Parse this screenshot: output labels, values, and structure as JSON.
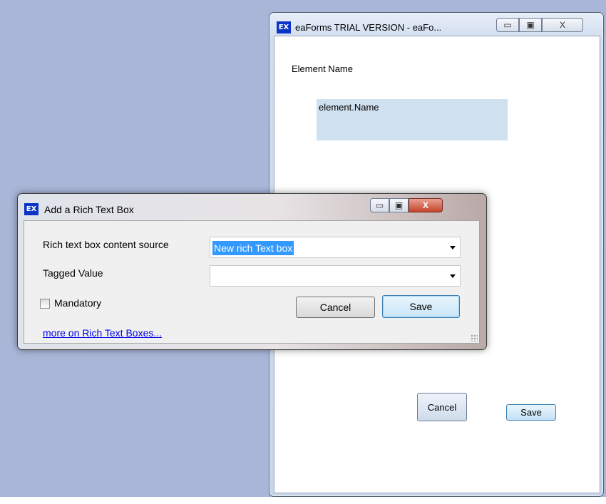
{
  "back_window": {
    "icon": "EX",
    "title": "eaForms TRIAL VERSION - eaFo...",
    "caption": {
      "minimize": "▭",
      "maximize": "▣",
      "close": "X"
    },
    "element_name_label": "Element Name",
    "element_field_value": "element.Name",
    "cancel_label": "Cancel",
    "save_label": "Save"
  },
  "dialog": {
    "icon": "EX",
    "title": "Add a Rich Text Box",
    "caption": {
      "minimize": "▭",
      "maximize": "▣",
      "close": "X"
    },
    "content_source_label": "Rich text box content source",
    "content_source_value": "New rich Text box",
    "tagged_value_label": "Tagged Value",
    "tagged_value_value": "",
    "mandatory_label": "Mandatory",
    "mandatory_checked": false,
    "cancel_label": "Cancel",
    "save_label": "Save",
    "help_link": "more on Rich Text Boxes..."
  },
  "colors": {
    "desktop": "#a9b6d8",
    "selection": "#3399ff",
    "link": "#0000ee",
    "icon_bg": "#0c35c8"
  }
}
